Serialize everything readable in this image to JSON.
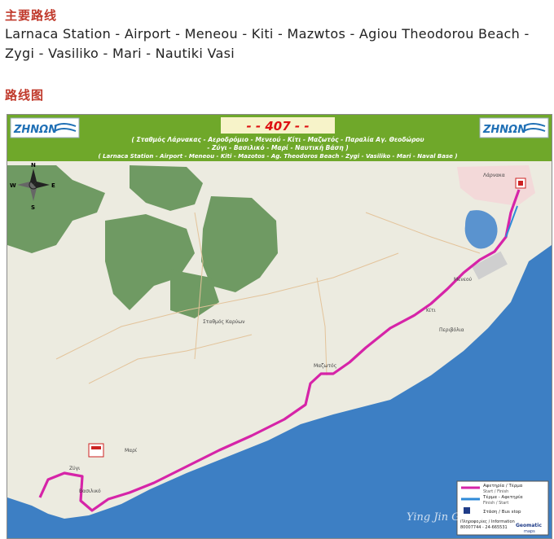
{
  "article": {
    "section_route_heading": "主要路线",
    "route_line_1": "Larnaca Station - Airport - Meneou - Kiti - Mazwtos - Agiou Theodorou Beach -",
    "route_line_2": "Zygi - Vasiliko - Mari - Nautiki Vasi",
    "section_map_heading": "路线图"
  },
  "map": {
    "logo_left": "ZHNΩN",
    "logo_right": "ZHNΩN",
    "route_number": "- -  407  - -",
    "greek_stops_line1": "( Σταθμός Λάρνακας - Αεροδρόμιο - Μενεού - Κίτι - Μαζωτός - Παραλία Αγ. Θεοδώρου",
    "greek_stops_line2": "- Ζύγι - Βασιλικό - Μαρί - Ναυτική Βάση )",
    "english_stops_line": "( Larnaca Station - Airport - Meneou - Kiti - Mazotos - Ag. Theodoros Beach - Zygi - Vasiliko - Mari - Naval Base )",
    "compass": {
      "n": "N",
      "s": "S",
      "e": "E",
      "w": "W"
    },
    "legend": {
      "item1_gr": "Αφετηρία / Τέρμα",
      "item1_en": "Start / Finish",
      "item2_gr": "Τέρμα - Αφετηρία",
      "item2_en": "Finish / Start",
      "item3": "Στάση / Bus stop",
      "info_gr": "Πληροφορίες / Information",
      "info_phone": "80007744 - 24-665531",
      "brand": "Geomatic",
      "brand_sub": "maps"
    },
    "watermark": "Ying Jin Group",
    "place_labels": {
      "larnaca": "Λάρνακα",
      "meneou": "Μενεού",
      "kiti": "Κίτι",
      "mazotos": "Μαζωτός",
      "zygi": "Ζύγι",
      "mari": "Μαρί",
      "vasiliko": "Βασιλικό",
      "perivolia": "Περιβόλια",
      "station": "Σταθμός Καρύων"
    },
    "colors": {
      "header_bg": "#6fa82a",
      "land": "#ecebe0",
      "forest": "#6f9a63",
      "sea": "#3d7fc4",
      "route": "#d624a8",
      "route_alt": "#2f8ad8"
    }
  }
}
